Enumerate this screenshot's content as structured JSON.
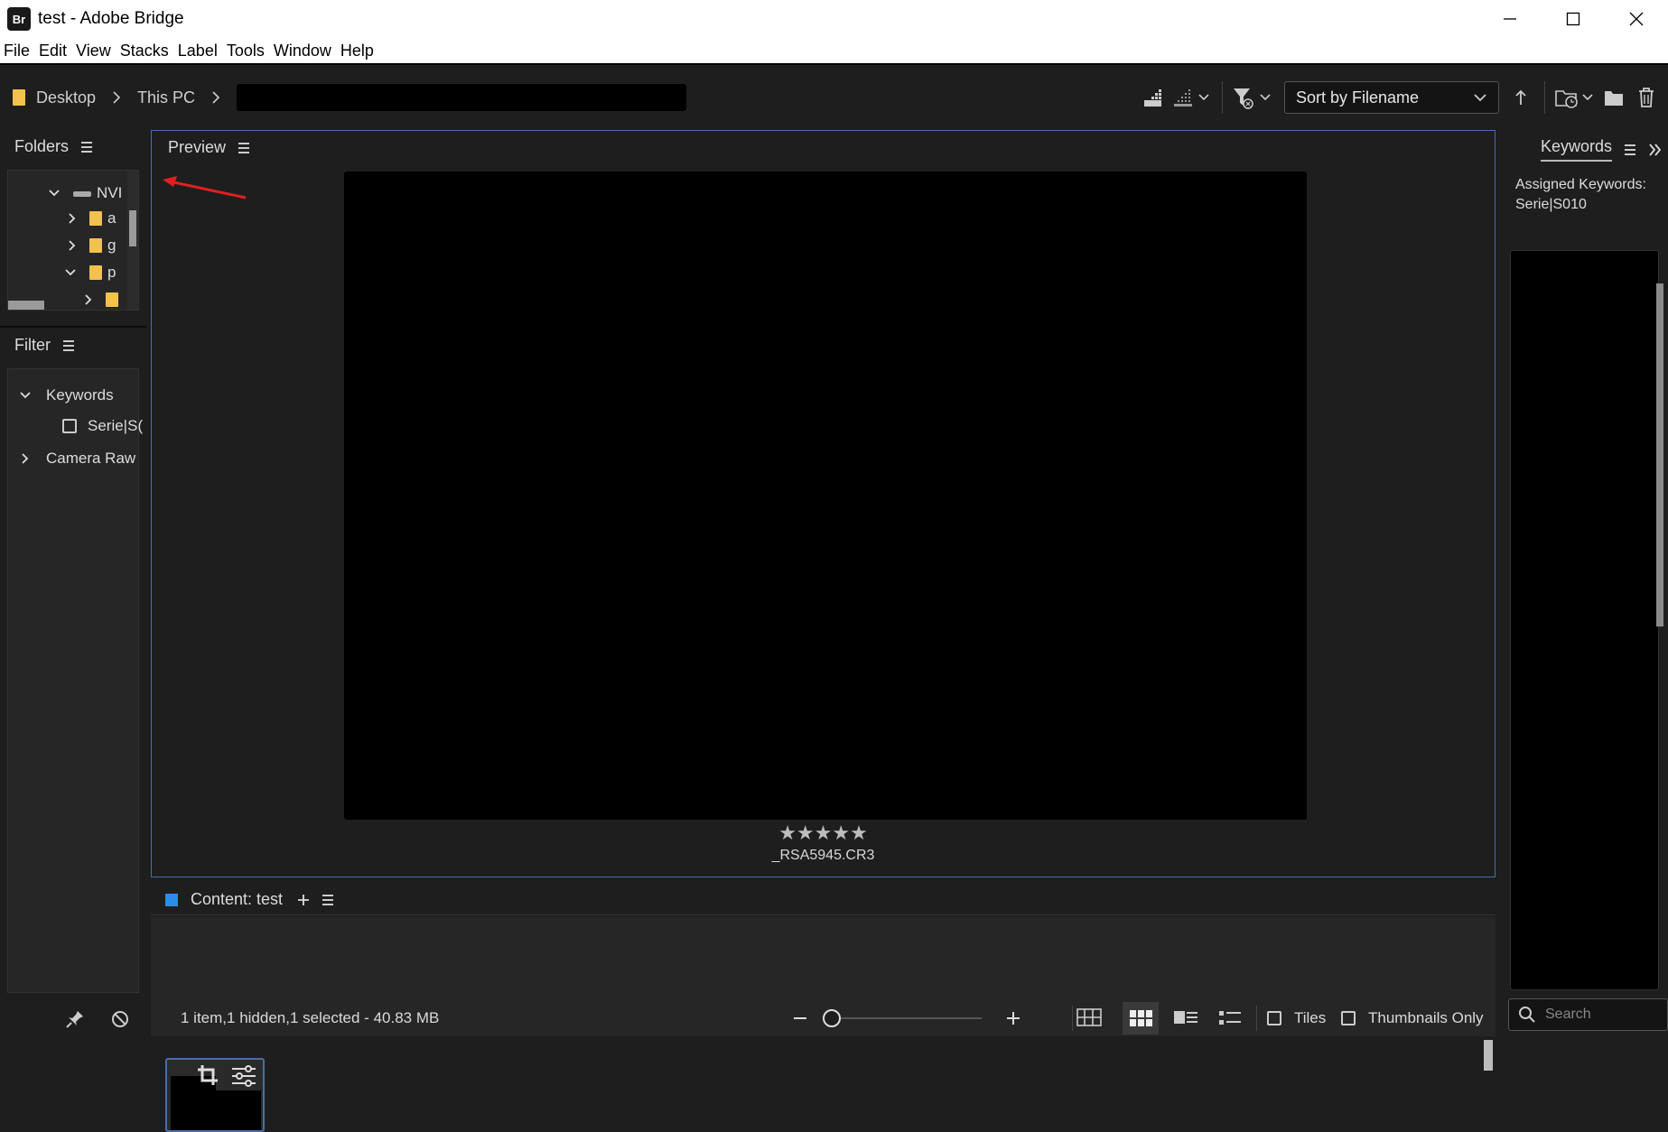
{
  "window": {
    "app_icon": "Br",
    "title": "test - Adobe Bridge"
  },
  "menu": [
    "File",
    "Edit",
    "View",
    "Stacks",
    "Label",
    "Tools",
    "Window",
    "Help"
  ],
  "path": {
    "crumbs": [
      "Desktop",
      "This PC"
    ]
  },
  "toolbar": {
    "sort_label": "Sort by Filename"
  },
  "folders": {
    "title": "Folders",
    "root": "NVI",
    "items": [
      "a",
      "g",
      "p",
      ""
    ]
  },
  "filter": {
    "title": "Filter",
    "keywords_label": "Keywords",
    "keyword_item": "Serie|S(",
    "camera_raw_label": "Camera Raw"
  },
  "preview": {
    "title": "Preview",
    "rating_stars": "★★★★★",
    "filename": "_RSA5945.CR3"
  },
  "content": {
    "title": "Content: test"
  },
  "keywords": {
    "tab": "Keywords",
    "assigned_label": "Assigned Keywords:",
    "assigned_value": "Serie|S010",
    "search_placeholder": "Search"
  },
  "status": {
    "text": "1 item,1 hidden,1 selected - 40.83 MB",
    "tiles_label": "Tiles",
    "thumbs_only_label": "Thumbnails Only"
  },
  "colors": {
    "accent_blue": "#2d8ceb",
    "folder_yellow": "#f2c14e",
    "selection_border": "#4a6ea9",
    "annotation_red": "#e02020"
  }
}
